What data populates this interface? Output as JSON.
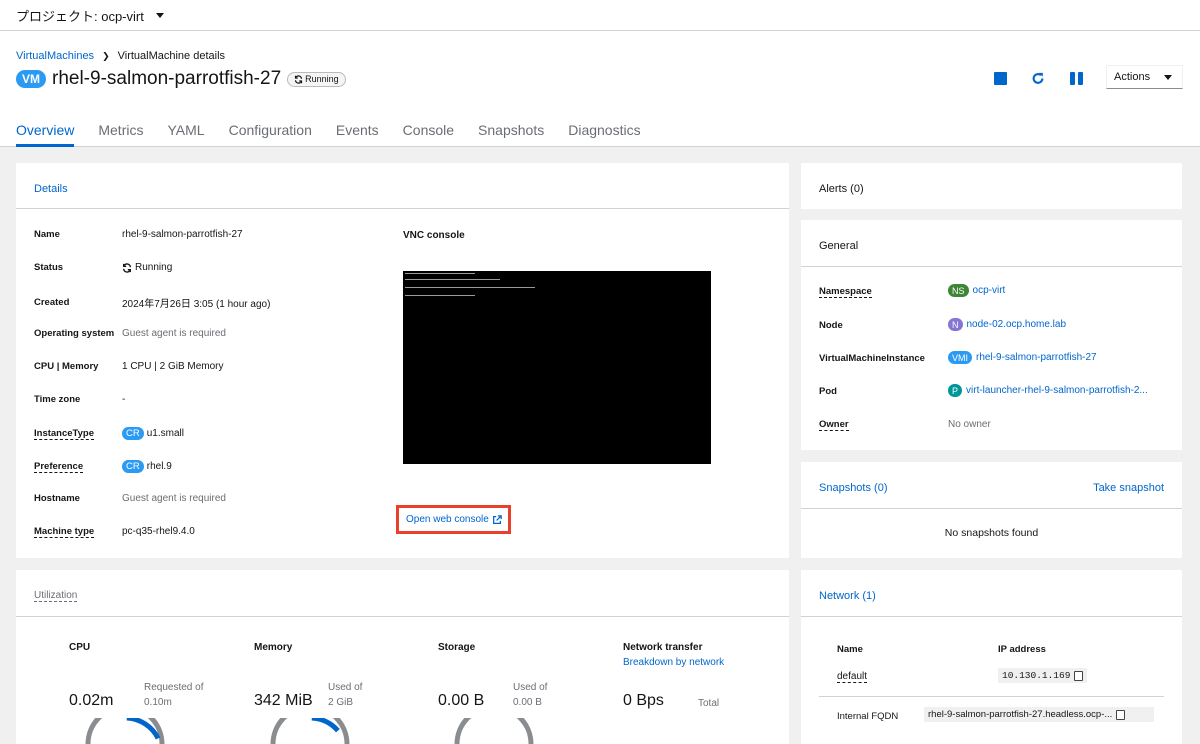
{
  "project_bar": {
    "label": "プロジェクト: ocp-virt"
  },
  "breadcrumb": {
    "parent": "VirtualMachines",
    "current": "VirtualMachine details"
  },
  "title": {
    "badge": "VM",
    "name": "rhel-9-salmon-parrotfish-27",
    "status": "Running"
  },
  "actions": {
    "label": "Actions"
  },
  "tabs": [
    "Overview",
    "Metrics",
    "YAML",
    "Configuration",
    "Events",
    "Console",
    "Snapshots",
    "Diagnostics"
  ],
  "details": {
    "title": "Details",
    "rows": [
      {
        "label": "Name",
        "value": "rhel-9-salmon-parrotfish-27"
      },
      {
        "label": "Status",
        "value": "Running"
      },
      {
        "label": "Created",
        "value": "2024年7月26日 3:05 (1 hour ago)"
      },
      {
        "label": "Operating system",
        "value": "Guest agent is required"
      },
      {
        "label": "CPU | Memory",
        "value": "1 CPU | 2 GiB Memory"
      },
      {
        "label": "Time zone",
        "value": "-"
      },
      {
        "label": "InstanceType",
        "badge": "CR",
        "value": "u1.small"
      },
      {
        "label": "Preference",
        "badge": "CR",
        "value": "rhel.9"
      },
      {
        "label": "Hostname",
        "value": "Guest agent is required"
      },
      {
        "label": "Machine type",
        "value": "pc-q35-rhel9.4.0"
      }
    ],
    "vnc_label": "VNC console",
    "open_console": "Open web console"
  },
  "alerts": {
    "title": "Alerts (0)"
  },
  "general": {
    "title": "General",
    "rows": [
      {
        "label": "Namespace",
        "badge": "NS",
        "badge_color": "#3e8635",
        "value": "ocp-virt"
      },
      {
        "label": "Node",
        "badge": "N",
        "badge_color": "#8476d1",
        "value": "node-02.ocp.home.lab"
      },
      {
        "label": "VirtualMachineInstance",
        "badge": "VMI",
        "badge_color": "#2b9af3",
        "value": "rhel-9-salmon-parrotfish-27"
      },
      {
        "label": "Pod",
        "badge": "P",
        "badge_color": "#009596",
        "value": "virt-launcher-rhel-9-salmon-parrotfish-2..."
      },
      {
        "label": "Owner",
        "value": "No owner"
      }
    ]
  },
  "snapshots": {
    "title": "Snapshots (0)",
    "take": "Take snapshot",
    "empty": "No snapshots found"
  },
  "utilization": {
    "title": "Utilization",
    "cpu": {
      "label": "CPU",
      "value": "0.02m",
      "sub1": "Requested of",
      "sub2": "0.10m",
      "fill": 0.22
    },
    "memory": {
      "label": "Memory",
      "value": "342 MiB",
      "sub1": "Used of",
      "sub2": "2 GiB",
      "fill": 0.17
    },
    "storage": {
      "label": "Storage",
      "value": "0.00 B",
      "sub1": "Used of",
      "sub2": "0.00 B",
      "fill": 0
    },
    "network": {
      "label": "Network transfer",
      "link": "Breakdown by network",
      "value": "0 Bps",
      "sub": "Total"
    }
  },
  "network": {
    "title": "Network (1)",
    "col_name": "Name",
    "col_ip": "IP address",
    "row_name": "default",
    "row_ip": "10.130.1.169",
    "fqdn_label": "Internal FQDN",
    "fqdn_value": "rhel-9-salmon-parrotfish-27.headless.ocp-..."
  },
  "colors": {
    "accent": "#0066cc",
    "badge_blue": "#2b9af3",
    "highlight": "#e8402b"
  }
}
